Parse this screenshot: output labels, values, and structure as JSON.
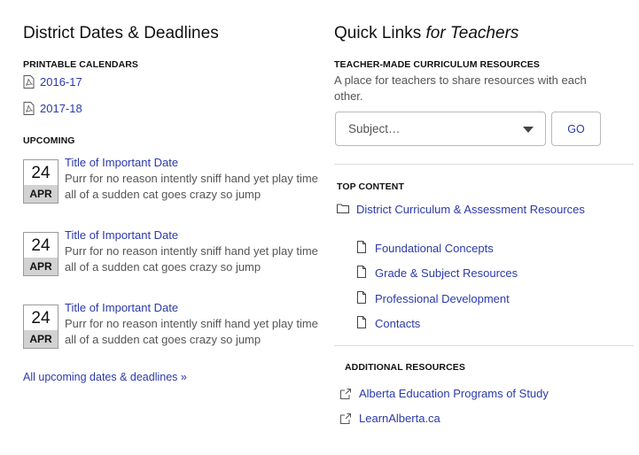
{
  "district": {
    "heading": "District Dates & Deadlines",
    "printable_label": "PRINTABLE CALENDARS",
    "calendars": [
      "2016-17",
      "2017-18"
    ],
    "upcoming_label": "UPCOMING",
    "events": [
      {
        "day": "24",
        "month": "APR",
        "title": "Title of Important Date",
        "description": "Purr for no reason intently sniff hand yet play time all of a sudden cat goes crazy so jump"
      },
      {
        "day": "24",
        "month": "APR",
        "title": "Title of Important Date",
        "description": "Purr for no reason intently sniff hand yet play time all of a sudden cat goes crazy so jump"
      },
      {
        "day": "24",
        "month": "APR",
        "title": "Title of Important Date",
        "description": "Purr for no reason intently sniff hand yet play time all of a sudden cat goes crazy so jump"
      }
    ],
    "all_link": "All upcoming dates & deadlines »"
  },
  "quick_links": {
    "heading_main": "Quick Links",
    "heading_em": "for Teachers",
    "curriculum_label": "TEACHER-MADE CURRICULUM RESOURCES",
    "curriculum_desc": "A place for teachers to share resources with each other.",
    "subject_placeholder": "Subject…",
    "go_label": "GO",
    "top_content_label": "TOP CONTENT",
    "top_folder": "District Curriculum & Assessment Resources",
    "top_items": [
      "Foundational Concepts",
      "Grade & Subject Resources",
      "Professional Development",
      "Contacts"
    ],
    "additional_label": "ADDITIONAL RESOURCES",
    "additional_items": [
      "Alberta Education Programs of Study",
      "LearnAlberta.ca"
    ]
  }
}
